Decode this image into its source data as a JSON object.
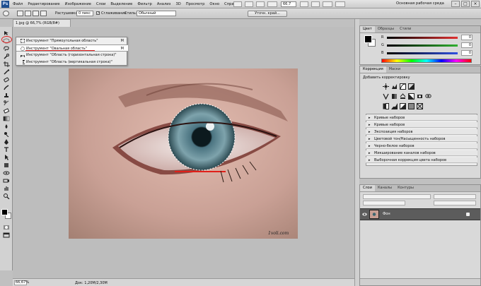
{
  "menubar": {
    "logo": "Ps",
    "items": [
      "Файл",
      "Редактирование",
      "Изображение",
      "Слои",
      "Выделение",
      "Фильтр",
      "Анализ",
      "3D",
      "Просмотр",
      "Окно",
      "Справка"
    ],
    "zoom": "66,7",
    "workspace": "Основная рабочая среда"
  },
  "options": {
    "feather_label": "Растушевка:",
    "feather_value": "0 пикс",
    "antialias_label": "Сглаживание",
    "antialias_checked": "✓",
    "style_label": "Стиль:",
    "style_value": "Обычный",
    "refine_button": "Уточн. край..."
  },
  "document": {
    "tab": "1.jpg @ 66,7% (RGB/8#)",
    "watermark": "1voli.com"
  },
  "flyout": [
    {
      "label": "Инструмент \"Прямоугольная область\"",
      "key": "M"
    },
    {
      "label": "Инструмент \"Овальная область\"",
      "key": "M"
    },
    {
      "label": "Инструмент \"Область (горизонтальная строка)\"",
      "key": ""
    },
    {
      "label": "Инструмент \"Область (вертикальная строка)\"",
      "key": ""
    }
  ],
  "status": {
    "zoom": "66,67%",
    "doc": "Док: 1,20M/2,30M"
  },
  "color_panel": {
    "tabs": [
      "Цвет",
      "Образцы",
      "Стили"
    ],
    "channels": [
      {
        "label": "R",
        "value": "0",
        "color": "#e03030"
      },
      {
        "label": "G",
        "value": "0",
        "color": "#30b030"
      },
      {
        "label": "B",
        "value": "0",
        "color": "#3050e0"
      }
    ]
  },
  "adjust_panel": {
    "tabs": [
      "Коррекция",
      "Маски"
    ],
    "title": "Добавить корректировку",
    "presets": [
      "Кривые наборов",
      "Кривые наборов",
      "Экспозиция наборов",
      "Цветовой тон/Насыщенность наборов",
      "Черно-белое наборов",
      "Микширование каналов наборов",
      "Выборочная коррекция цвета наборов"
    ]
  },
  "layers_panel": {
    "tabs": [
      "Слои",
      "Каналы",
      "Контуры"
    ],
    "layer_name": "Фон"
  }
}
